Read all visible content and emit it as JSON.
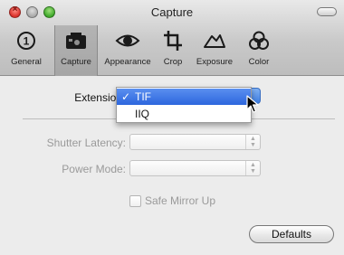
{
  "window": {
    "title": "Capture"
  },
  "toolbar": {
    "items": [
      {
        "label": "General",
        "icon": "general-info-icon"
      },
      {
        "label": "Capture",
        "icon": "camera-icon",
        "selected": true
      },
      {
        "label": "Appearance",
        "icon": "eye-icon"
      },
      {
        "label": "Crop",
        "icon": "crop-icon"
      },
      {
        "label": "Exposure",
        "icon": "exposure-icon"
      },
      {
        "label": "Color",
        "icon": "color-circles-icon"
      }
    ]
  },
  "content": {
    "extension": {
      "label": "Extension",
      "options": [
        "TIF",
        "IIQ"
      ],
      "selected": "TIF",
      "check_mark": "✓"
    },
    "shutter_latency": {
      "label": "Shutter Latency:",
      "value": "",
      "enabled": false
    },
    "power_mode": {
      "label": "Power Mode:",
      "value": "",
      "enabled": false
    },
    "safe_mirror_up": {
      "label": "Safe Mirror Up",
      "checked": false,
      "enabled": false
    },
    "defaults_button": {
      "label": "Defaults"
    }
  },
  "colors": {
    "menu_highlight": "#2d66dd",
    "close_button": "#d9302a",
    "zoom_button": "#3ea82a"
  }
}
